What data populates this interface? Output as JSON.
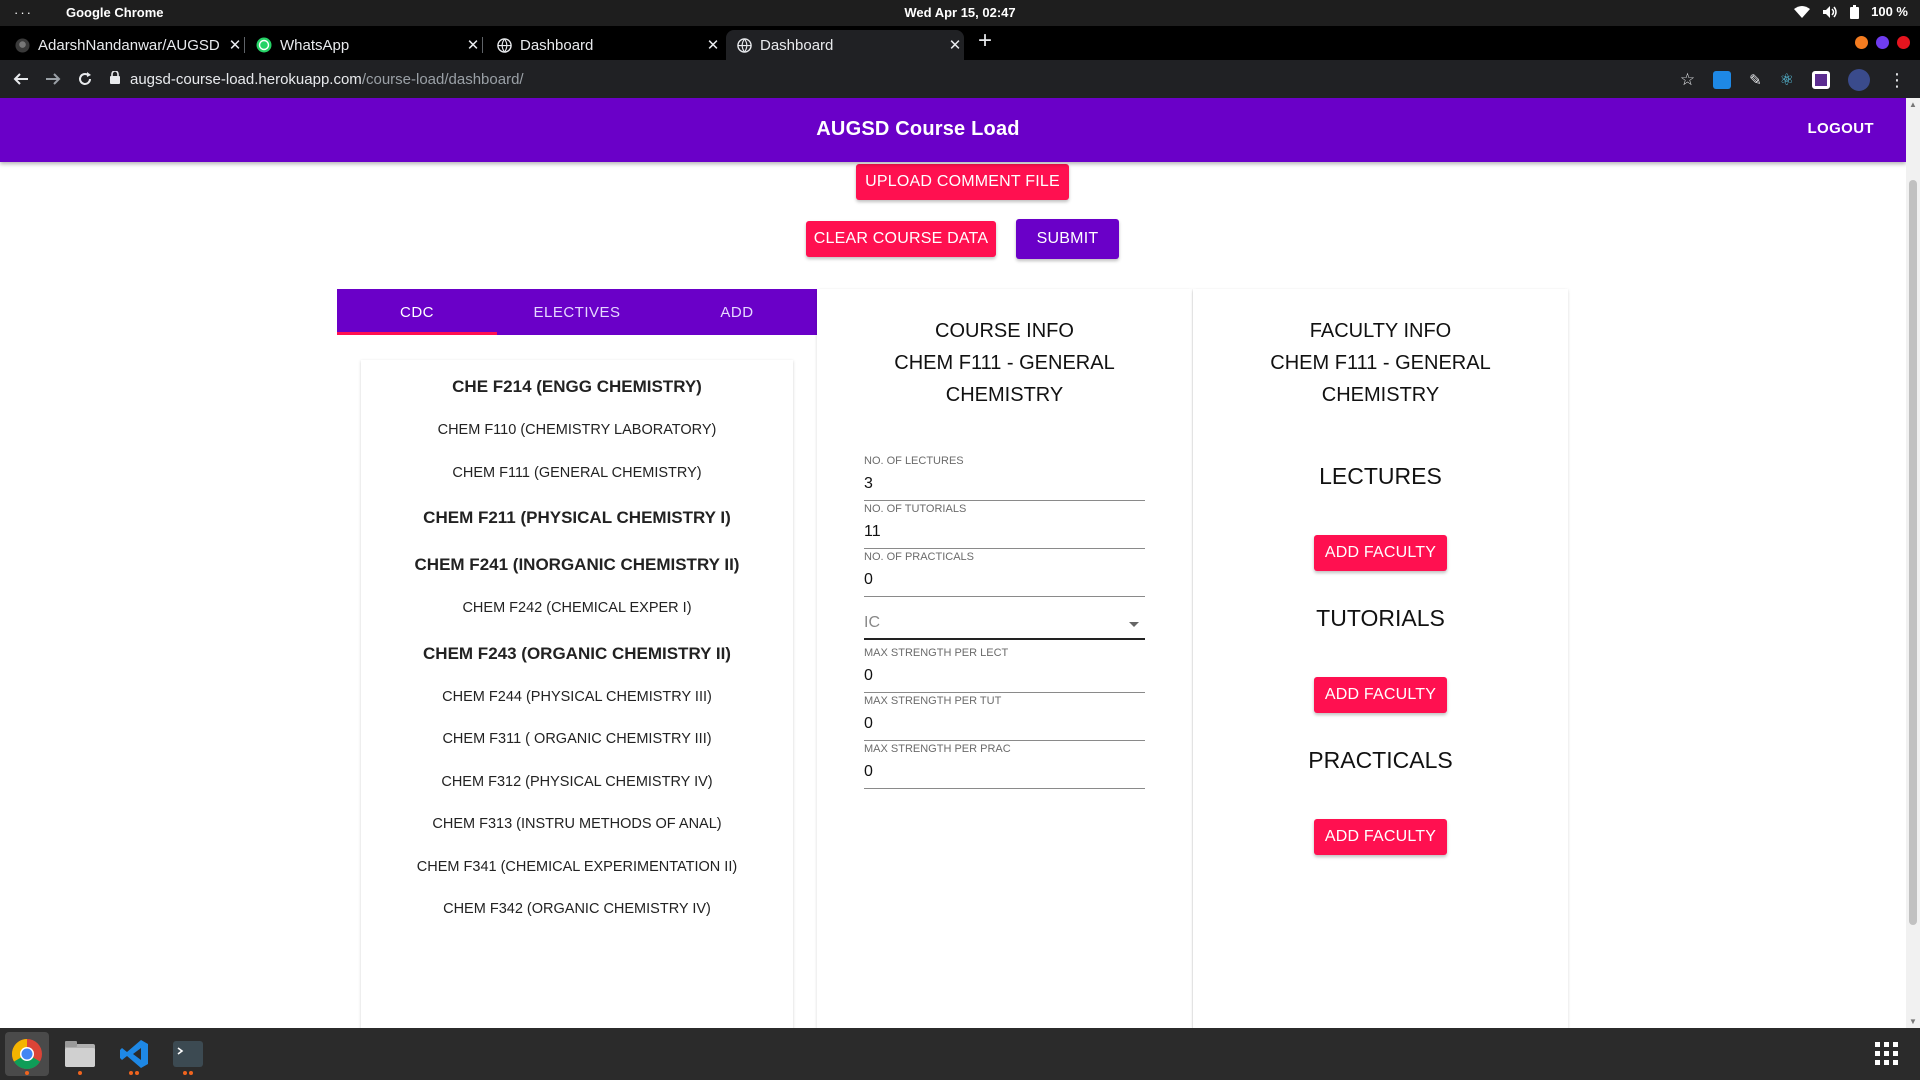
{
  "system": {
    "dots": "···",
    "app_name": "Google Chrome",
    "clock": "Wed Apr 15, 02:47",
    "battery": "100 %"
  },
  "browser": {
    "tabs": [
      {
        "title": "AdarshNandanwar/AUGSD",
        "icon": "github-icon"
      },
      {
        "title": "WhatsApp",
        "icon": "whatsapp-icon"
      },
      {
        "title": "Dashboard",
        "icon": "globe-icon"
      },
      {
        "title": "Dashboard",
        "icon": "globe-icon"
      }
    ],
    "url_host": "augsd-course-load.herokuapp.com",
    "url_path": "/course-load/dashboard/"
  },
  "app": {
    "brand": "AUGSD Course Load",
    "logout": "LOGOUT",
    "upload_comment": "UPLOAD COMMENT FILE",
    "clear_course": "CLEAR COURSE DATA",
    "submit": "SUBMIT",
    "tabs": [
      "CDC",
      "ELECTIVES",
      "ADD"
    ],
    "courses": [
      "CHE F214 (ENGG CHEMISTRY)",
      "CHEM F110 (CHEMISTRY LABORATORY)",
      "CHEM F111 (GENERAL CHEMISTRY)",
      "CHEM F211 (PHYSICAL CHEMISTRY I)",
      "CHEM F241 (INORGANIC CHEMISTRY II)",
      "CHEM F242 (CHEMICAL EXPER I)",
      "CHEM F243 (ORGANIC CHEMISTRY II)",
      "CHEM F244 (PHYSICAL CHEMISTRY III)",
      "CHEM F311 ( ORGANIC CHEMISTRY III)",
      "CHEM F312 (PHYSICAL CHEMISTRY IV)",
      "CHEM F313 (INSTRU METHODS OF ANAL)",
      "CHEM F341 (CHEMICAL EXPERIMENTATION II)",
      "CHEM F342 (ORGANIC CHEMISTRY IV)"
    ],
    "course_info": {
      "heading1": "COURSE INFO",
      "heading2": "CHEM F111 - GENERAL",
      "heading3": "CHEMISTRY",
      "lectures_label": "NO. OF LECTURES",
      "lectures_value": "3",
      "tutorials_label": "NO. OF TUTORIALS",
      "tutorials_value": "11",
      "practicals_label": "NO. OF PRACTICALS",
      "practicals_value": "0",
      "ic_placeholder": "IC",
      "max_lect_label": "MAX STRENGTH PER LECT",
      "max_lect_value": "0",
      "max_tut_label": "MAX STRENGTH PER TUT",
      "max_tut_value": "0",
      "max_prac_label": "MAX STRENGTH PER PRAC",
      "max_prac_value": "0"
    },
    "faculty_info": {
      "heading1": "FACULTY INFO",
      "heading2": "CHEM F111 - GENERAL",
      "heading3": "CHEMISTRY",
      "lectures": "LECTURES",
      "tutorials": "TUTORIALS",
      "practicals": "PRACTICALS",
      "add_faculty": "ADD FACULTY"
    }
  },
  "colors": {
    "primary": "#6a00c8",
    "accent": "#ff1050"
  }
}
